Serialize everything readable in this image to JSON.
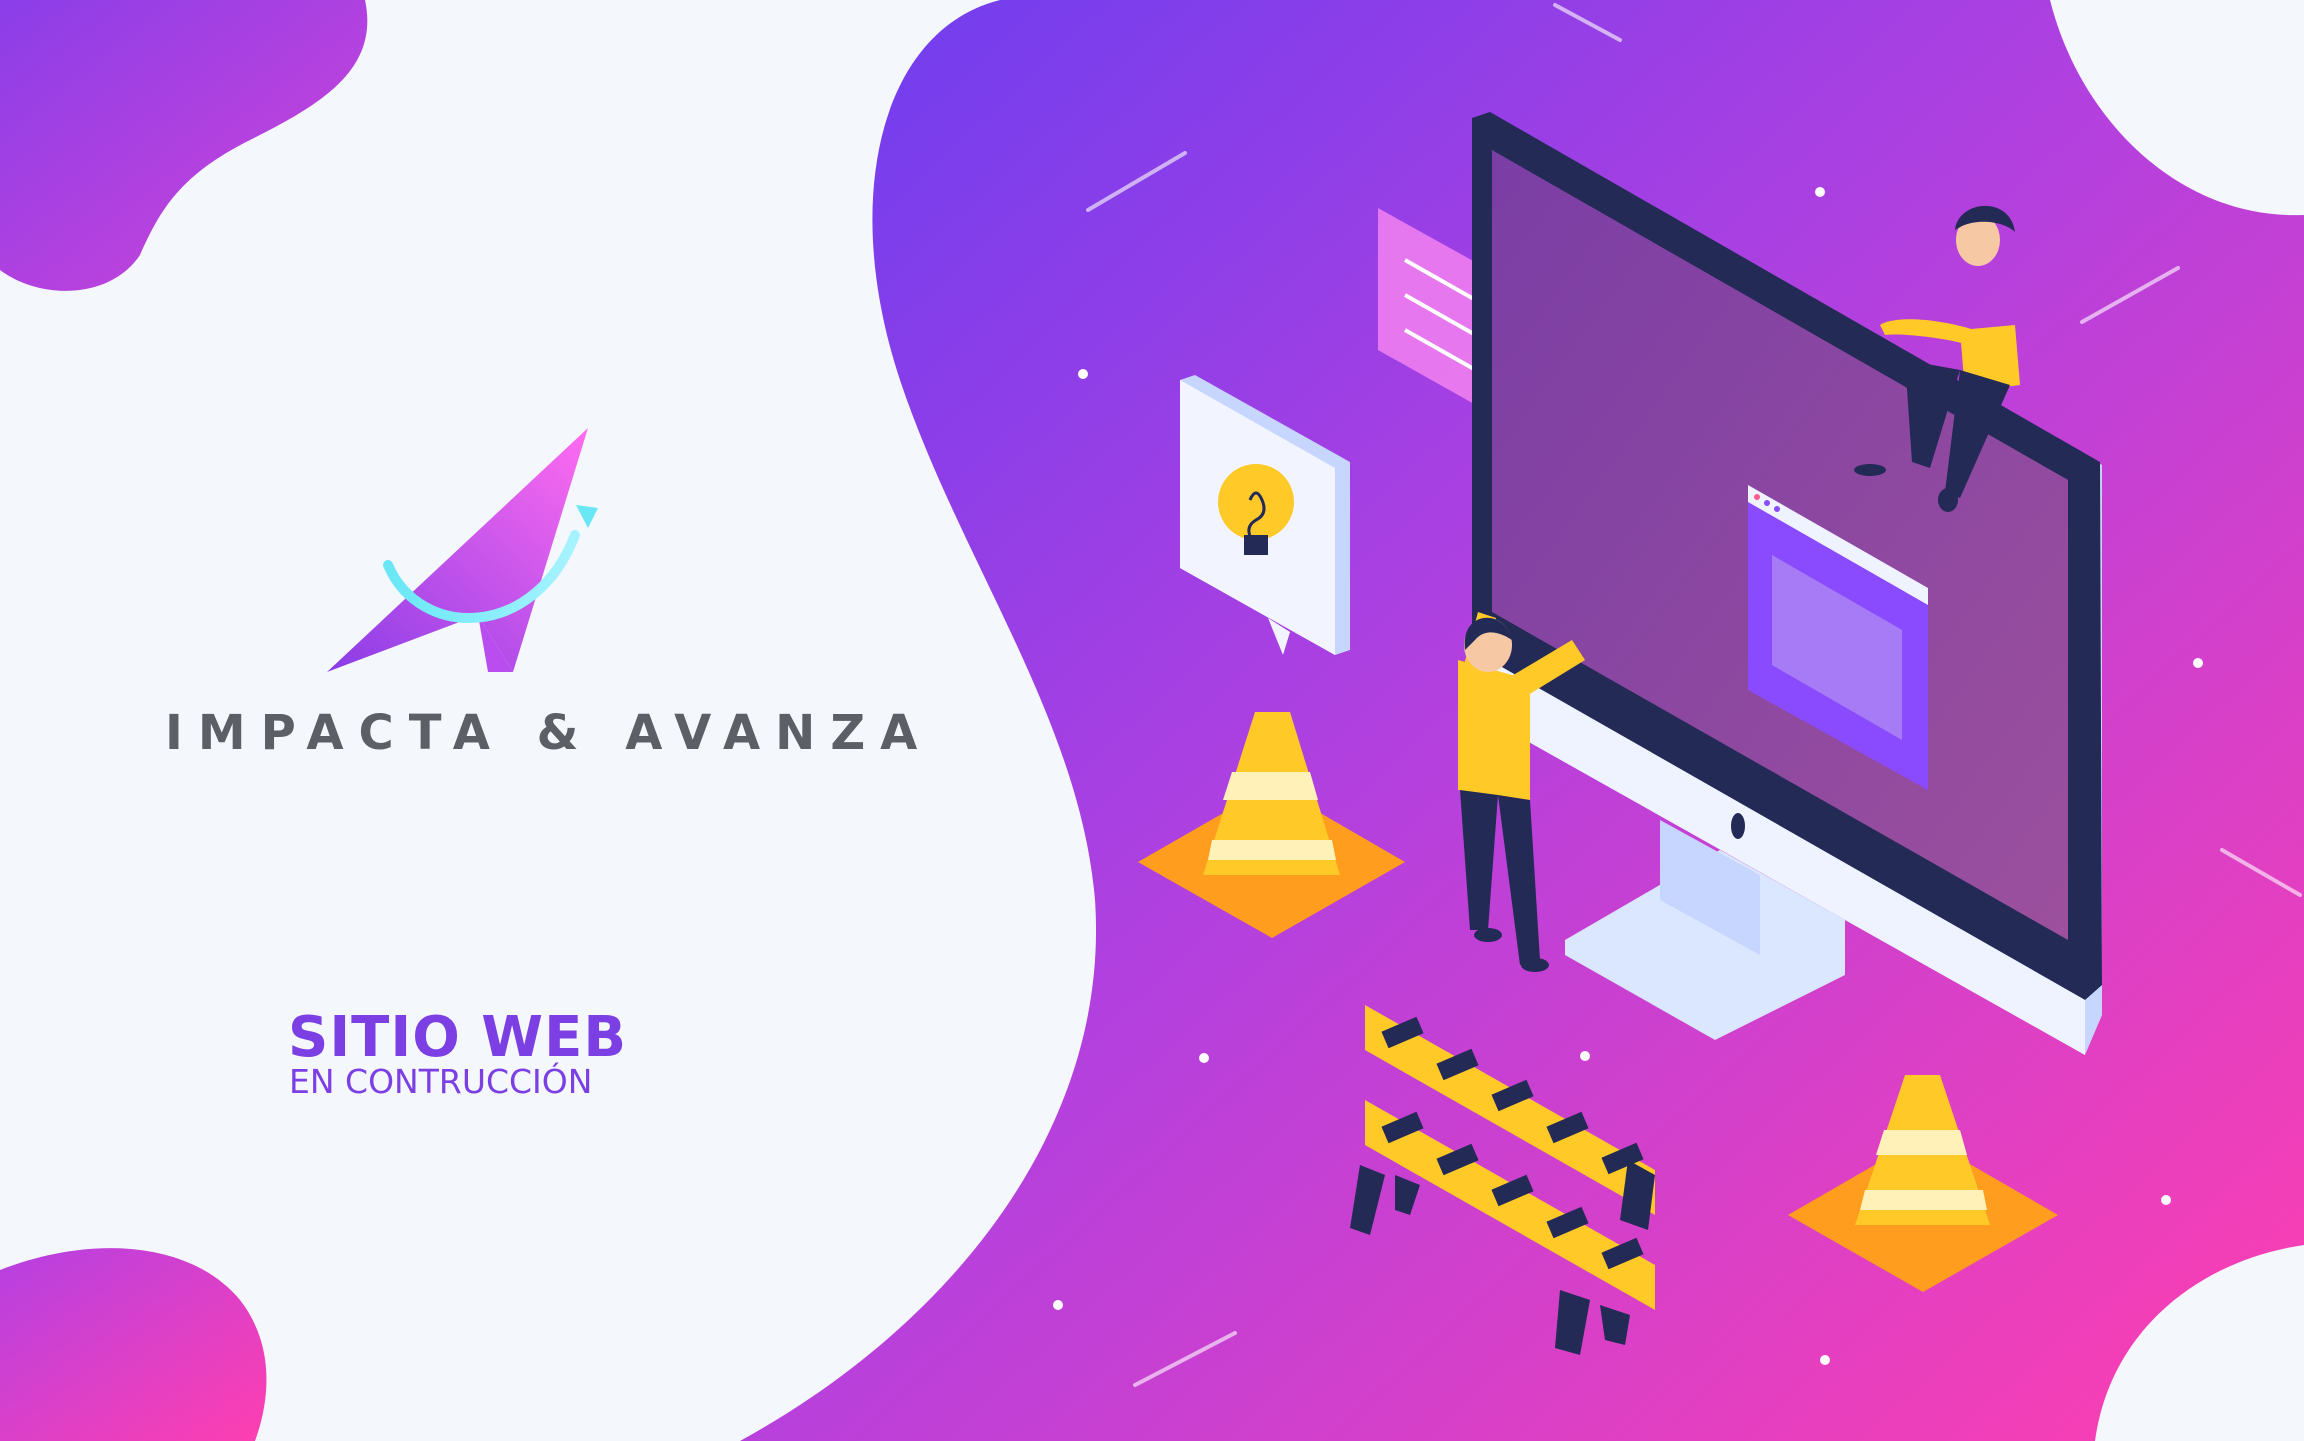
{
  "brand": {
    "name": "IMPACTA & AVANZA"
  },
  "status": {
    "title": "SITIO WEB",
    "subtitle": "EN CONTRUCCIÓN"
  },
  "colors": {
    "gradient_start": "#6a3df0",
    "gradient_mid": "#b040e0",
    "gradient_end": "#ff3fb0",
    "accent_yellow": "#ffc928",
    "accent_orange": "#ff9d1e",
    "text_gray": "#5c5f66",
    "text_purple": "#7b3fe4",
    "navy": "#232a55"
  }
}
